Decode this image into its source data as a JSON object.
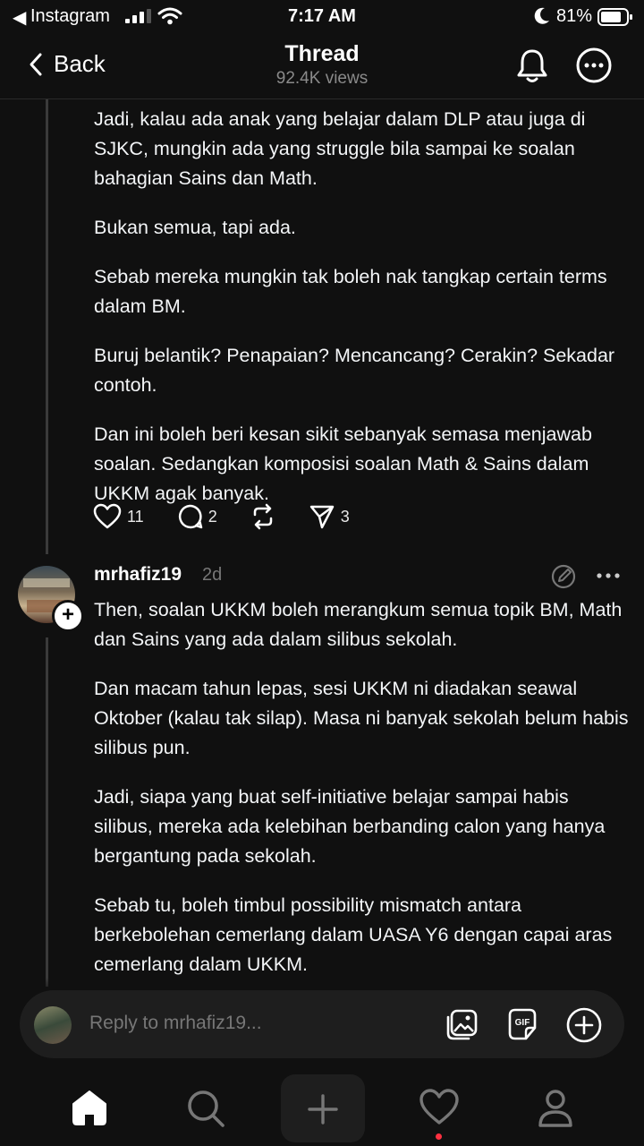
{
  "status_bar": {
    "back_app": "Instagram",
    "time": "7:17 AM",
    "battery": "81%"
  },
  "header": {
    "back_label": "Back",
    "title": "Thread",
    "views": "92.4K views"
  },
  "post1": {
    "paragraphs": [
      "Jadi, kalau ada anak yang belajar dalam DLP atau juga di SJKC, mungkin ada yang struggle bila sampai ke soalan bahagian Sains dan Math.",
      "Bukan semua, tapi ada.",
      "Sebab mereka mungkin tak boleh nak tangkap certain terms dalam BM.",
      "Buruj belantik? Penapaian?  Mencancang? Cerakin? Sekadar contoh.",
      "Dan ini boleh beri kesan sikit sebanyak semasa menjawab soalan. Sedangkan komposisi soalan Math & Sains dalam UKKM agak banyak."
    ],
    "likes": "11",
    "comments": "2",
    "shares": "3"
  },
  "post2": {
    "username": "mrhafiz19",
    "time_ago": "2d",
    "paragraphs": [
      "Then, soalan UKKM boleh merangkum semua topik BM, Math dan Sains yang ada dalam silibus sekolah.",
      "Dan macam tahun lepas, sesi UKKM ni diadakan seawal Oktober (kalau tak silap). Masa ni banyak sekolah belum habis silibus pun.",
      "Jadi, siapa yang buat self-initiative belajar sampai habis silibus, mereka ada kelebihan berbanding calon yang hanya bergantung pada sekolah.",
      "Sebab tu, boleh timbul possibility mismatch antara berkebolehan cemerlang dalam UASA Y6 dengan capai aras cemerlang dalam UKKM."
    ]
  },
  "reply": {
    "placeholder": "Reply to mrhafiz19..."
  }
}
